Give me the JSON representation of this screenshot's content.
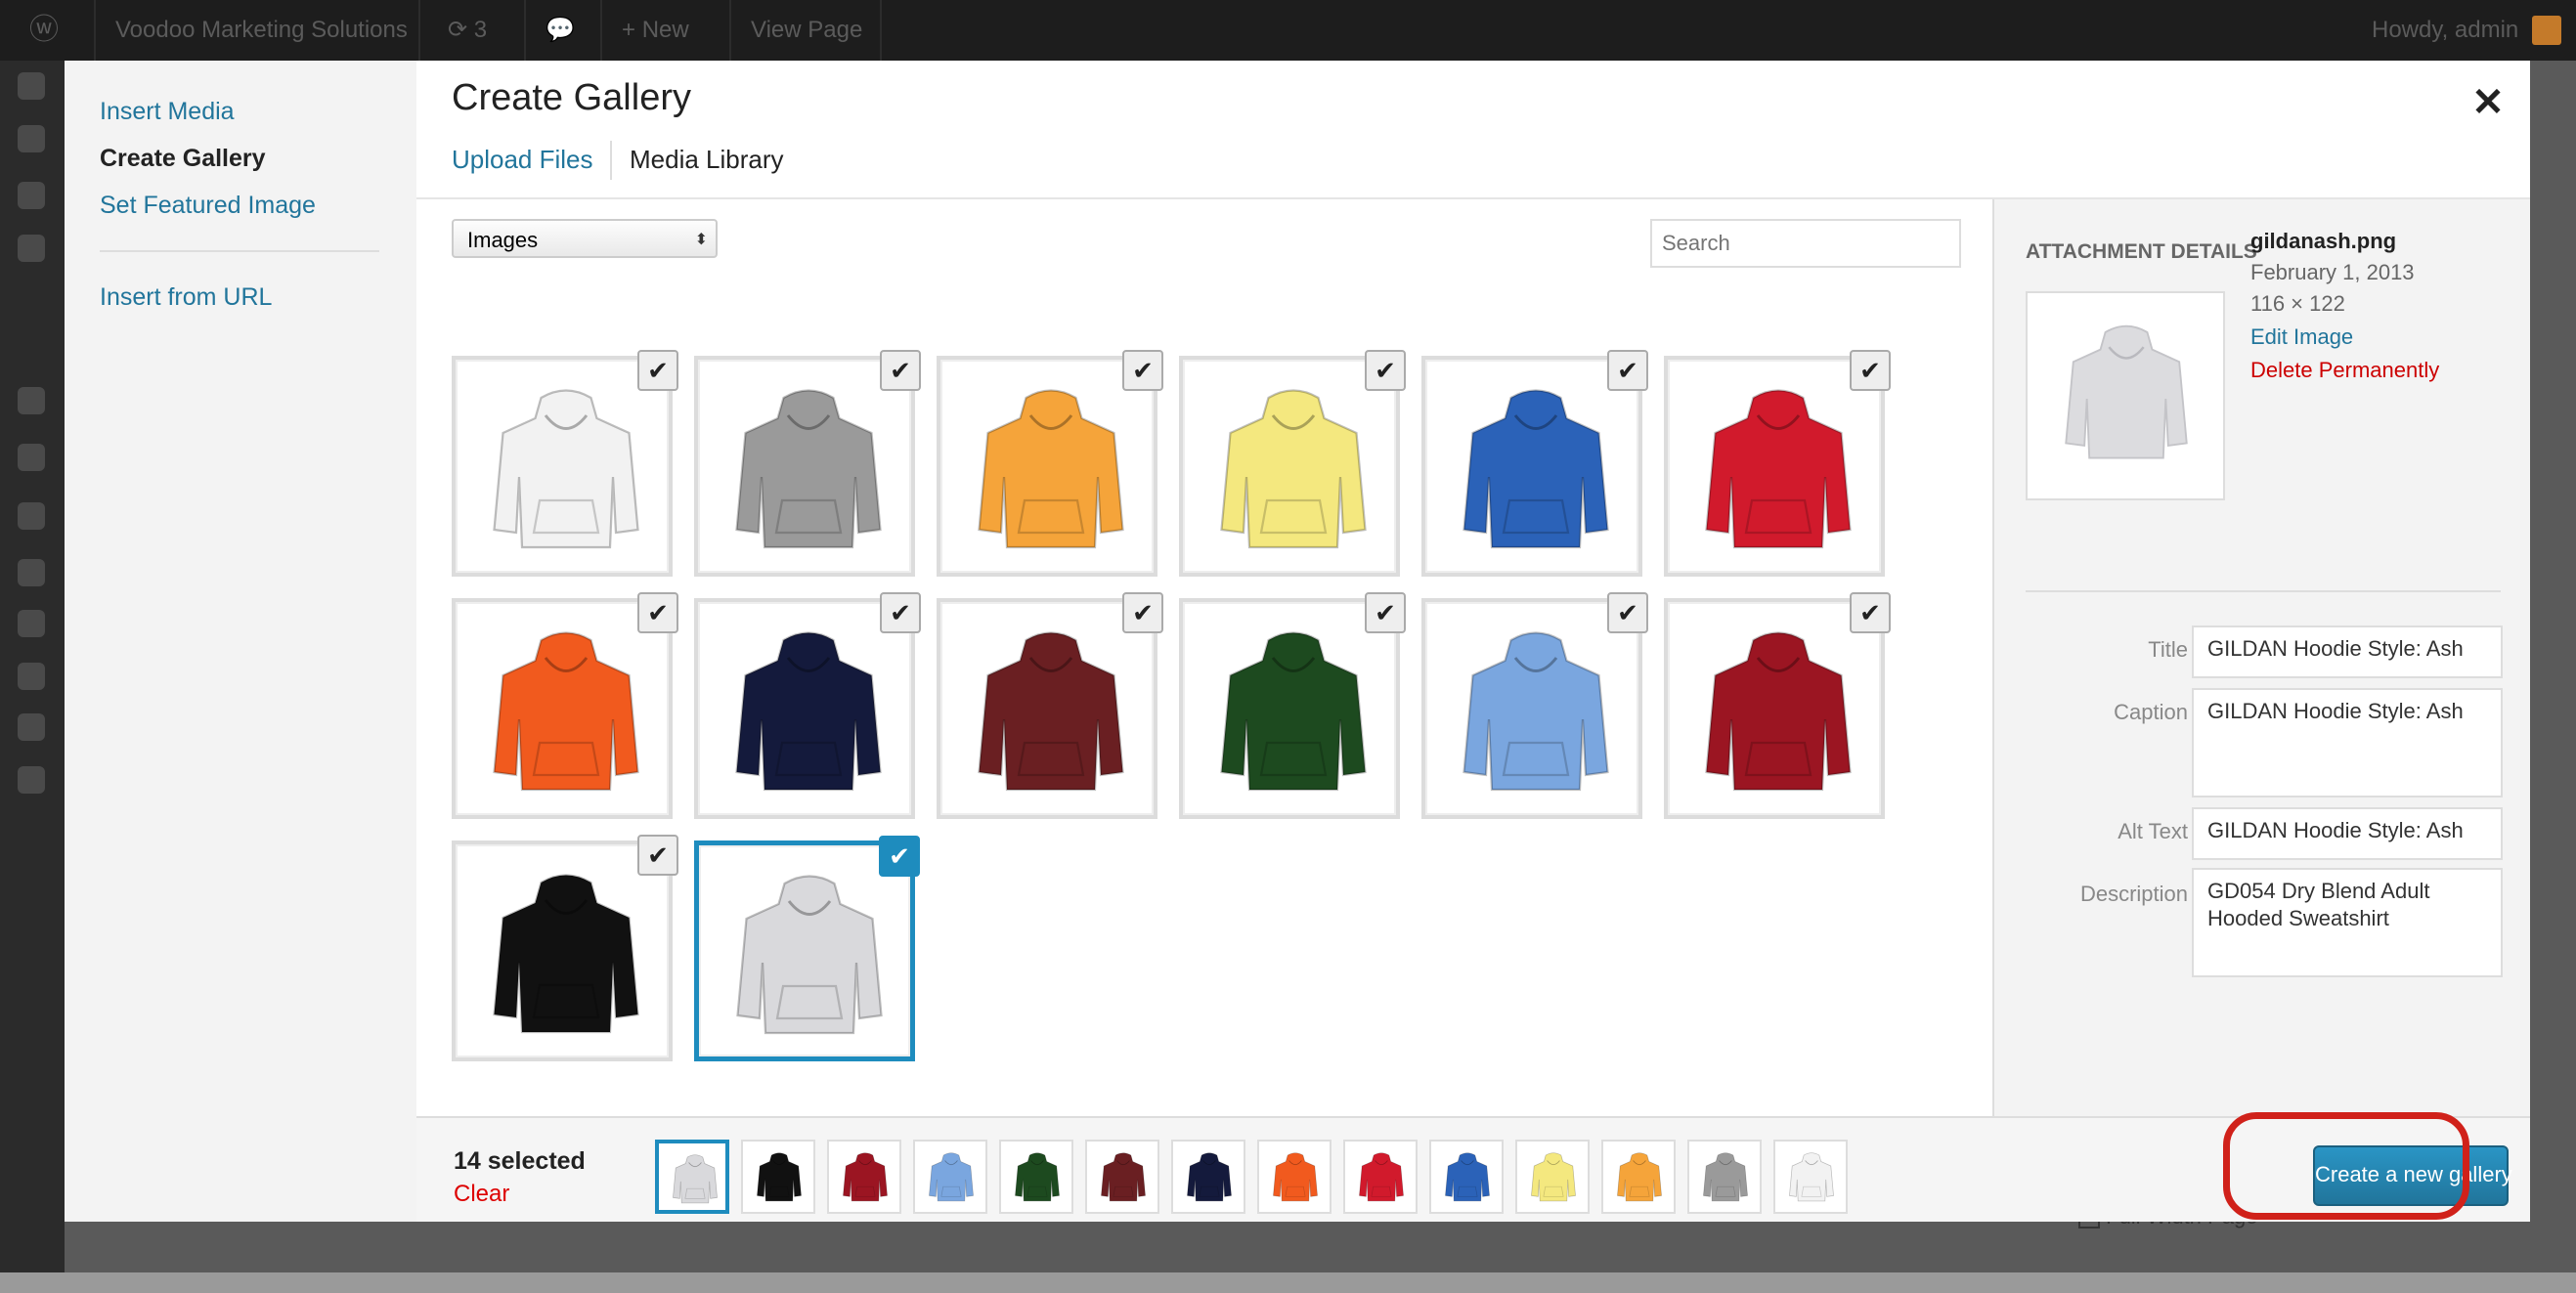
{
  "admin_bar": {
    "site_name": "Voodoo Marketing Solutions",
    "updates_count": "3",
    "new_label": "New",
    "view_page_label": "View Page",
    "howdy": "Howdy, admin"
  },
  "modal": {
    "title": "Create Gallery",
    "menu": {
      "items": [
        {
          "label": "Insert Media"
        },
        {
          "label": "Create Gallery"
        },
        {
          "label": "Set Featured Image"
        },
        {
          "label": "Insert from URL"
        }
      ]
    },
    "router": {
      "upload": "Upload Files",
      "library": "Media Library"
    },
    "filter": {
      "selected": "Images"
    },
    "search": {
      "placeholder": "Search"
    },
    "attachments": [
      {
        "color": "#f2f2f2",
        "selected": true
      },
      {
        "color": "#9a9a9a",
        "selected": true
      },
      {
        "color": "#f5a43a",
        "selected": true
      },
      {
        "color": "#f4e87f",
        "selected": true
      },
      {
        "color": "#2b62b8",
        "selected": true
      },
      {
        "color": "#d11a2c",
        "selected": true
      },
      {
        "color": "#f15a1e",
        "selected": true
      },
      {
        "color": "#141a3c",
        "selected": true
      },
      {
        "color": "#6a1f22",
        "selected": true
      },
      {
        "color": "#1d4a1f",
        "selected": true
      },
      {
        "color": "#7aa6df",
        "selected": true
      },
      {
        "color": "#9b1522",
        "selected": true
      },
      {
        "color": "#111111",
        "selected": true
      },
      {
        "color": "#d9d9dc",
        "selected": true,
        "active": true
      }
    ],
    "attachment_details": {
      "heading": "ATTACHMENT DETAILS",
      "filename": "gildanash.png",
      "date": "February 1, 2013",
      "dimensions": "116 × 122",
      "edit_link": "Edit Image",
      "delete_link": "Delete Permanently",
      "fields": {
        "title_label": "Title",
        "title_value": "GILDAN Hoodie Style: Ash",
        "caption_label": "Caption",
        "caption_value": "GILDAN Hoodie Style: Ash",
        "alt_label": "Alt Text",
        "alt_value": "GILDAN Hoodie Style: Ash",
        "description_label": "Description",
        "description_value": "GD054 Dry Blend Adult Hooded Sweatshirt"
      }
    },
    "selection": {
      "count_label": "14 selected",
      "clear_label": "Clear",
      "thumbs": [
        "#d9d9dc",
        "#111111",
        "#9b1522",
        "#7aa6df",
        "#1d4a1f",
        "#6a1f22",
        "#141a3c",
        "#f15a1e",
        "#d11a2c",
        "#2b62b8",
        "#f4e87f",
        "#f5a43a",
        "#9a9a9a",
        "#f2f2f2"
      ]
    },
    "create_button": "Create a new gallery",
    "close_icon": "close-icon"
  },
  "background_page": {
    "checkbox_label": "Full Width Page"
  }
}
